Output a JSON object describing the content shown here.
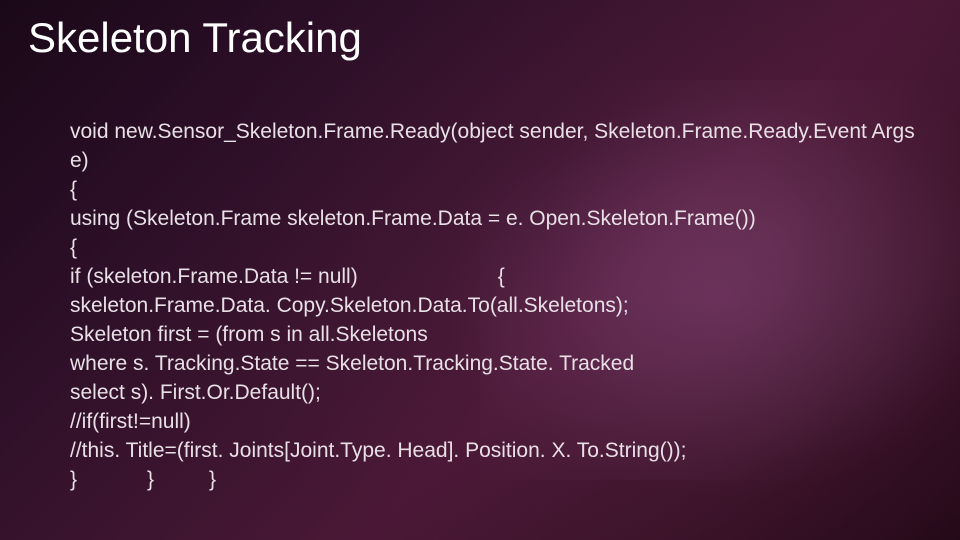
{
  "title": "Skeleton Tracking",
  "code": {
    "l1": "void new.Sensor_Skeleton.Frame.Ready(object sender, Skeleton.Frame.Ready.Event Args e)",
    "l2": "{",
    "l3": "using (Skeleton.Frame skeleton.Frame.Data = e. Open.Skeleton.Frame())",
    "l4": "{",
    "l5a": "if (skeleton.Frame.Data != null)",
    "l5b": "{",
    "l6": "skeleton.Frame.Data. Copy.Skeleton.Data.To(all.Skeletons);",
    "l7": "Skeleton first = (from s in all.Skeletons",
    "l8": "where s. Tracking.State == Skeleton.Tracking.State. Tracked",
    "l9": "select s). First.Or.Default();",
    "l10": " //if(first!=null)",
    "l11": "//this. Title=(first. Joints[Joint.Type. Head]. Position. X. To.String());",
    "l12a": "}",
    "l12b": "}",
    "l12c": "}"
  }
}
